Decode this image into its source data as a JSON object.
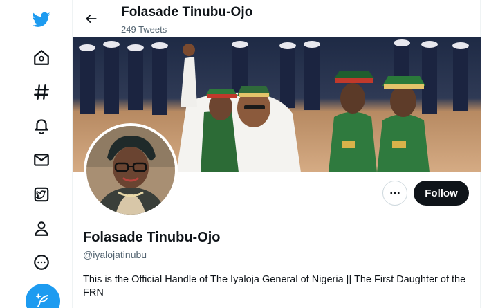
{
  "header": {
    "name": "Folasade Tinubu-Ojo",
    "tweet_count": "249 Tweets"
  },
  "profile": {
    "display_name": "Folasade Tinubu-Ojo",
    "handle": "@iyalojatinubu",
    "bio": "This is the Official Handle of The Iyaloja General of Nigeria || The First Daughter of the FRN",
    "follow_label": "Follow"
  },
  "nav": {
    "items": [
      "twitter-logo",
      "home",
      "explore",
      "notifications",
      "messages",
      "bookmarks",
      "profile",
      "more"
    ]
  },
  "colors": {
    "brand": "#1d9bf0",
    "follow_bg": "#0f1419",
    "secondary_text": "#536471"
  }
}
